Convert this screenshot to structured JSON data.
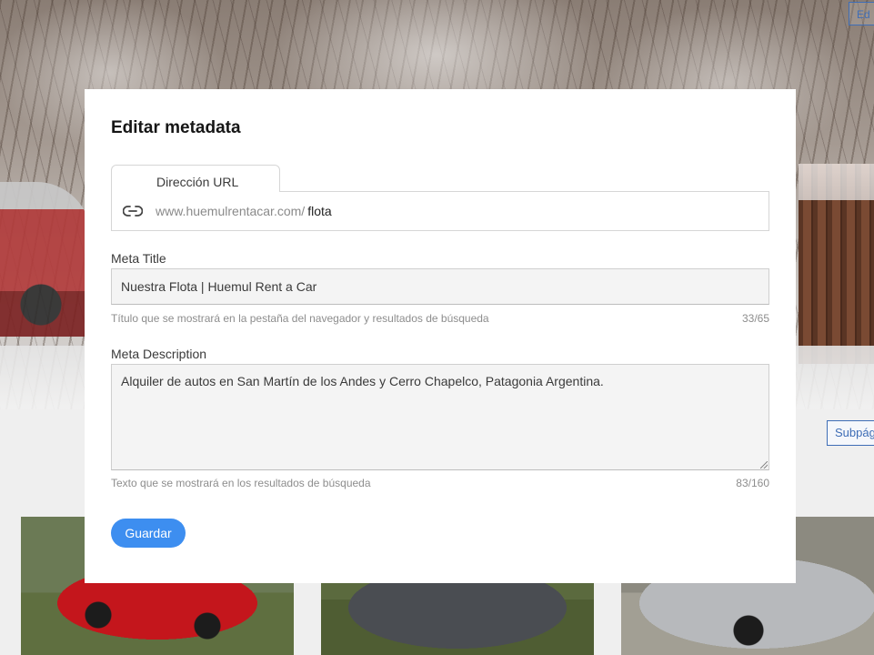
{
  "background": {
    "top_right_button_label": "Ed",
    "subpage_button_label": "Subpág"
  },
  "modal": {
    "title": "Editar metadata",
    "url": {
      "tab_label": "Dirección URL",
      "icon": "link-icon",
      "prefix": "www.huemulrentacar.com/",
      "slug": "flota"
    },
    "meta_title": {
      "label": "Meta Title",
      "value": "Nuestra Flota | Huemul Rent a Car",
      "helper": "Título que se mostrará en la pestaña del navegador y resultados de búsqueda",
      "counter": "33/65"
    },
    "meta_description": {
      "label": "Meta Description",
      "value": "Alquiler de autos en San Martín de los Andes y Cerro Chapelco, Patagonia Argentina.",
      "helper": "Texto que se mostrará en los resultados de búsqueda",
      "counter": "83/160"
    },
    "save_label": "Guardar"
  },
  "colors": {
    "primary": "#3d8ef0",
    "background_button_border": "#3e6db6"
  }
}
